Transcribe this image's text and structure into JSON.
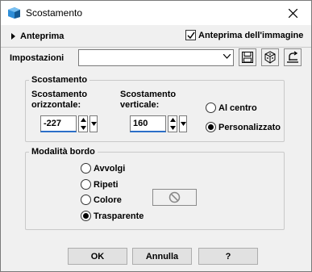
{
  "window": {
    "title": "Scostamento"
  },
  "header": {
    "preview_toggle_label": "Anteprima",
    "image_preview_label": "Anteprima dell'immagine",
    "image_preview_checked": true
  },
  "presets": {
    "label": "Impostazioni",
    "value": ""
  },
  "offset": {
    "title": "Scostamento",
    "horizontal_label_line1": "Scostamento",
    "horizontal_label_line2": "orizzontale:",
    "horizontal_value": "-227",
    "vertical_label_line1": "Scostamento",
    "vertical_label_line2": "verticale:",
    "vertical_value": "160",
    "center_label": "Al centro",
    "custom_label": "Personalizzato",
    "selected": "custom"
  },
  "edge_mode": {
    "title": "Modalità bordo",
    "options": [
      "Avvolgi",
      "Ripeti",
      "Colore",
      "Trasparente"
    ],
    "selected": "Trasparente"
  },
  "buttons": {
    "ok": "OK",
    "cancel": "Annulla",
    "help": "?"
  },
  "colors": {
    "accent": "#2c6fc8",
    "background": "#f0f0f0"
  }
}
